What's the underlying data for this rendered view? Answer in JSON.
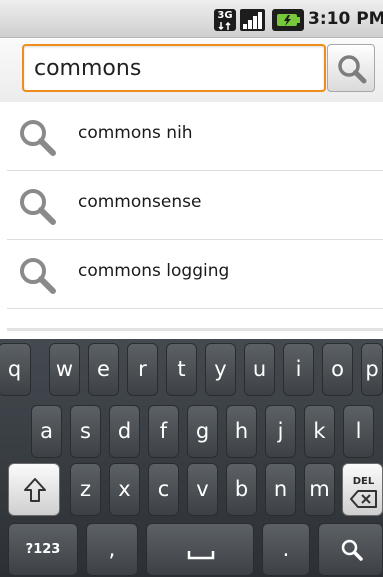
{
  "status_bar": {
    "network": "3G",
    "time": "3:10 PM",
    "icons": [
      "3g-icon",
      "signal-bars-icon",
      "battery-icon"
    ]
  },
  "search": {
    "value": "commons",
    "button_icon": "search-icon"
  },
  "suggestions": [
    {
      "text": "commons nih"
    },
    {
      "text": "commonsense"
    },
    {
      "text": "commons logging"
    }
  ],
  "keyboard": {
    "row1": [
      "q",
      "w",
      "e",
      "r",
      "t",
      "y",
      "u",
      "i",
      "o",
      "p"
    ],
    "row2": [
      "a",
      "s",
      "d",
      "f",
      "g",
      "h",
      "j",
      "k",
      "l"
    ],
    "row3": [
      "z",
      "x",
      "c",
      "v",
      "b",
      "n",
      "m"
    ],
    "shift_icon": "shift-arrow-icon",
    "delete_label": "DEL",
    "symbols_label": "?123",
    "comma": ",",
    "period": ".",
    "space_icon": "space-bar-icon",
    "search_icon": "search-icon"
  },
  "colors": {
    "accent": "#f08c1c",
    "keyboard_bg": "#3a3f44",
    "key_light": "#eeeeee",
    "key_dark": "#4a4f54"
  }
}
